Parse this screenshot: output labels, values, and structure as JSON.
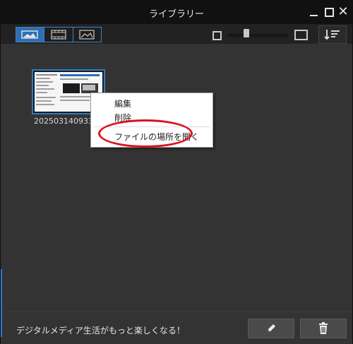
{
  "window": {
    "title": "ライブラリー",
    "close_glyph": "✕"
  },
  "toolbar": {
    "view_modes": [
      {
        "icon": "photo-thumbnail-icon"
      },
      {
        "icon": "filmstrip-icon"
      },
      {
        "icon": "landscape-icon"
      }
    ],
    "zoom_level": 0.3,
    "sort_icon": "sort-icon"
  },
  "library": {
    "items": [
      {
        "file_name": "20250314093302",
        "selected": true
      }
    ]
  },
  "context_menu": {
    "items": [
      {
        "label": "編集"
      },
      {
        "label": "削除"
      },
      {
        "label": "ファイルの場所を開く"
      }
    ]
  },
  "footer": {
    "tagline": "デジタルメディア生活がもっと楽しくなる！",
    "edit_icon": "pencil-icon",
    "delete_icon": "trash-icon"
  },
  "colors": {
    "accent": "#2f79c9",
    "highlight": "#d9131f"
  }
}
